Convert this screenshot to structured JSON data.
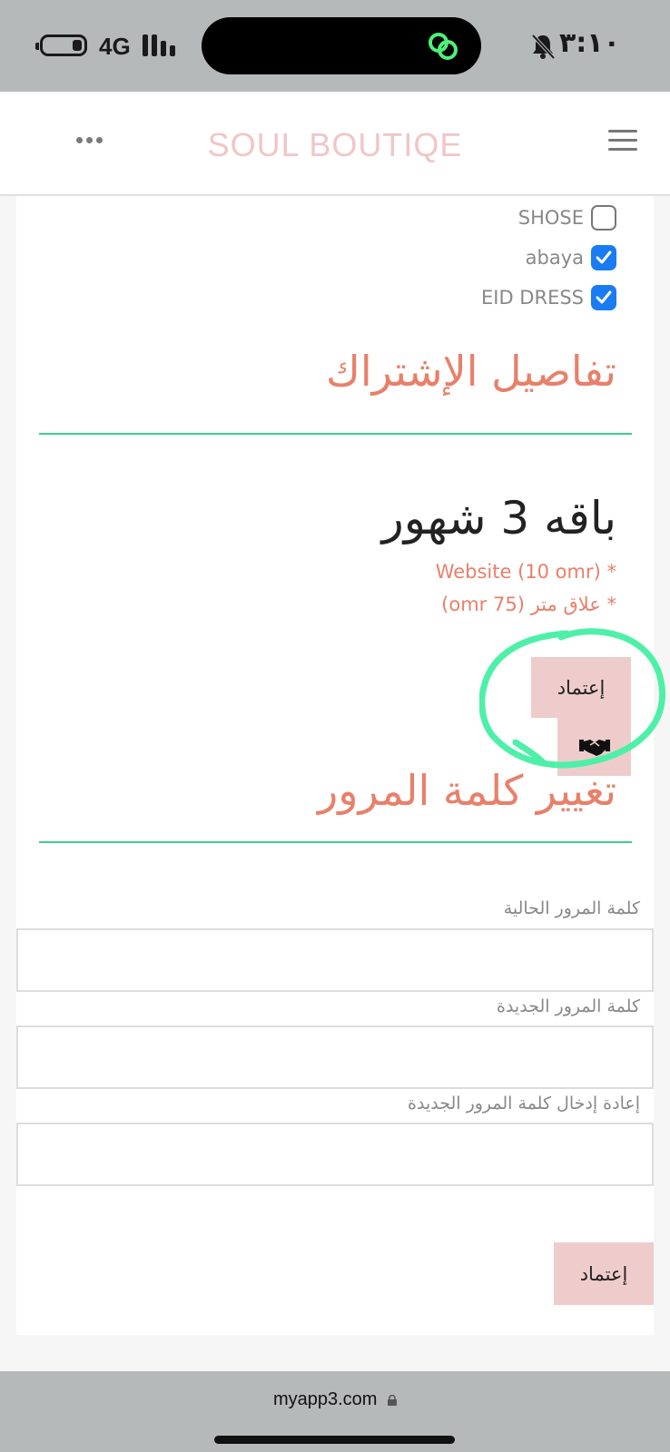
{
  "status_bar": {
    "network": "4G",
    "time": "٣:١٠"
  },
  "header": {
    "brand": "SOUL BOUTIQE"
  },
  "categories": [
    {
      "label": "SHOSE",
      "checked": false
    },
    {
      "label": "abaya",
      "checked": true
    },
    {
      "label": "EID DRESS",
      "checked": true
    }
  ],
  "subscription": {
    "section_title": "تفاصيل الإشتراك",
    "plan_name": "باقه 3 شهور",
    "items": [
      "* Website (10 omr)",
      "* علاق متر (75 omr)"
    ],
    "approve_label": "إعتماد"
  },
  "password": {
    "section_title": "تغيير كلمة المرور",
    "current_label": "كلمة المرور الحالية",
    "new_label": "كلمة المرور الجديدة",
    "confirm_label": "إعادة إدخال كلمة المرور الجديدة",
    "current_value": "",
    "new_value": "",
    "confirm_value": "",
    "submit_label": "إعتماد"
  },
  "browser": {
    "url": "myapp3.com"
  },
  "colors": {
    "accent_title": "#e8806a",
    "divider": "#39cf8f",
    "button_bg": "#efcccc",
    "brand": "#f0c6c6",
    "checkbox_checked": "#1a7cf2",
    "annotation": "#4ef0a8"
  },
  "icons": {
    "handshake": "handshake-icon",
    "more": "more-dots-icon",
    "menu": "hamburger-menu-icon",
    "lock": "lock-icon"
  }
}
